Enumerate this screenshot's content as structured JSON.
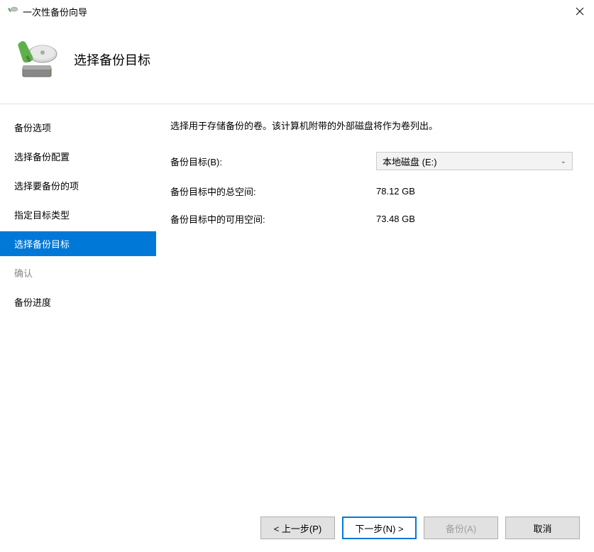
{
  "window": {
    "title": "一次性备份向导"
  },
  "header": {
    "title": "选择备份目标"
  },
  "sidebar": {
    "items": [
      {
        "label": "备份选项",
        "state": "normal"
      },
      {
        "label": "选择备份配置",
        "state": "normal"
      },
      {
        "label": "选择要备份的项",
        "state": "normal"
      },
      {
        "label": "指定目标类型",
        "state": "normal"
      },
      {
        "label": "选择备份目标",
        "state": "active"
      },
      {
        "label": "确认",
        "state": "disabled"
      },
      {
        "label": "备份进度",
        "state": "normal"
      }
    ]
  },
  "main": {
    "instruction": "选择用于存储备份的卷。该计算机附带的外部磁盘将作为卷列出。",
    "target_label": "备份目标(B):",
    "target_selected": "本地磁盘 (E:)",
    "total_space_label": "备份目标中的总空间:",
    "total_space_value": "78.12 GB",
    "free_space_label": "备份目标中的可用空间:",
    "free_space_value": "73.48 GB"
  },
  "buttons": {
    "prev": "< 上一步(P)",
    "next": "下一步(N) >",
    "backup": "备份(A)",
    "cancel": "取消"
  }
}
